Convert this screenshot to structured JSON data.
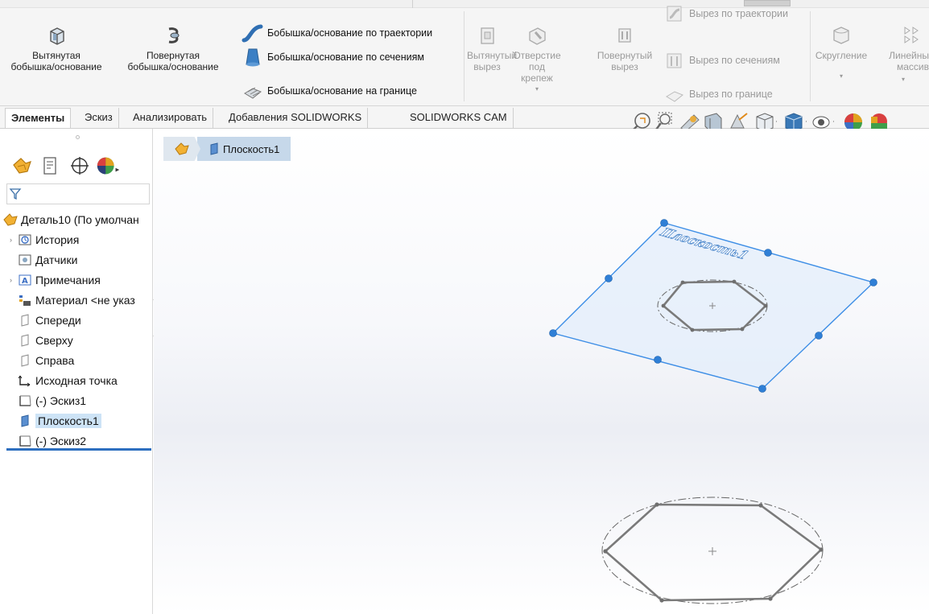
{
  "ribbon": {
    "extrude_boss": "Вытянутая\nбобышка/основание",
    "revolve_boss": "Повернутая\nбобышка/основание",
    "swept_boss": "Бобышка/основание по траектории",
    "loft_boss": "Бобышка/основание по сечениям",
    "boundary_boss": "Бобышка/основание на границе",
    "extruded_cut": "Вытянутый\nвырез",
    "hole_wizard": "Отверстие\nпод\nкрепеж",
    "revolved_cut": "Повернутый\nвырез",
    "swept_cut": "Вырез по траектории",
    "lofted_cut": "Вырез по сечениям",
    "boundary_cut": "Вырез по границе",
    "fillet": "Скругление",
    "linear_pattern": "Линейны\nмассив"
  },
  "tabs": [
    {
      "label": "Элементы",
      "active": true
    },
    {
      "label": "Эскиз",
      "active": false
    },
    {
      "label": "Анализировать",
      "active": false
    },
    {
      "label": "Добавления SOLIDWORKS",
      "active": false
    },
    {
      "label": "SOLIDWORKS CAM",
      "active": false
    }
  ],
  "tree": {
    "items": [
      {
        "label": "Деталь10  (По умолчан",
        "icon": "part-icon",
        "expand": false,
        "selected": false
      },
      {
        "label": "История",
        "icon": "history-icon",
        "expand": true,
        "selected": false
      },
      {
        "label": "Датчики",
        "icon": "sensors-icon",
        "expand": false,
        "selected": false
      },
      {
        "label": "Примечания",
        "icon": "annotations-icon",
        "expand": true,
        "selected": false
      },
      {
        "label": "Материал <не указ",
        "icon": "material-icon",
        "expand": false,
        "selected": false
      },
      {
        "label": "Спереди",
        "icon": "plane-icon",
        "expand": false,
        "selected": false
      },
      {
        "label": "Сверху",
        "icon": "plane-icon",
        "expand": false,
        "selected": false
      },
      {
        "label": "Справа",
        "icon": "plane-icon",
        "expand": false,
        "selected": false
      },
      {
        "label": "Исходная точка",
        "icon": "origin-icon",
        "expand": false,
        "selected": false
      },
      {
        "label": "(-) Эскиз1",
        "icon": "sketch-icon",
        "expand": false,
        "selected": false
      },
      {
        "label": "Плоскость1",
        "icon": "plane-solid-icon",
        "expand": false,
        "selected": true
      },
      {
        "label": "(-) Эскиз2",
        "icon": "sketch-icon",
        "expand": false,
        "selected": false
      }
    ]
  },
  "breadcrumb": {
    "item": "Плоскость1"
  },
  "viewport": {
    "plane_label": "Плоскость1"
  },
  "colors": {
    "accent": "#2d6fbf",
    "plane_edge": "#3d8ee6",
    "plane_fill": "#e3eefb",
    "sketch": "#7a7a7a",
    "selection": "#cde3f6"
  }
}
